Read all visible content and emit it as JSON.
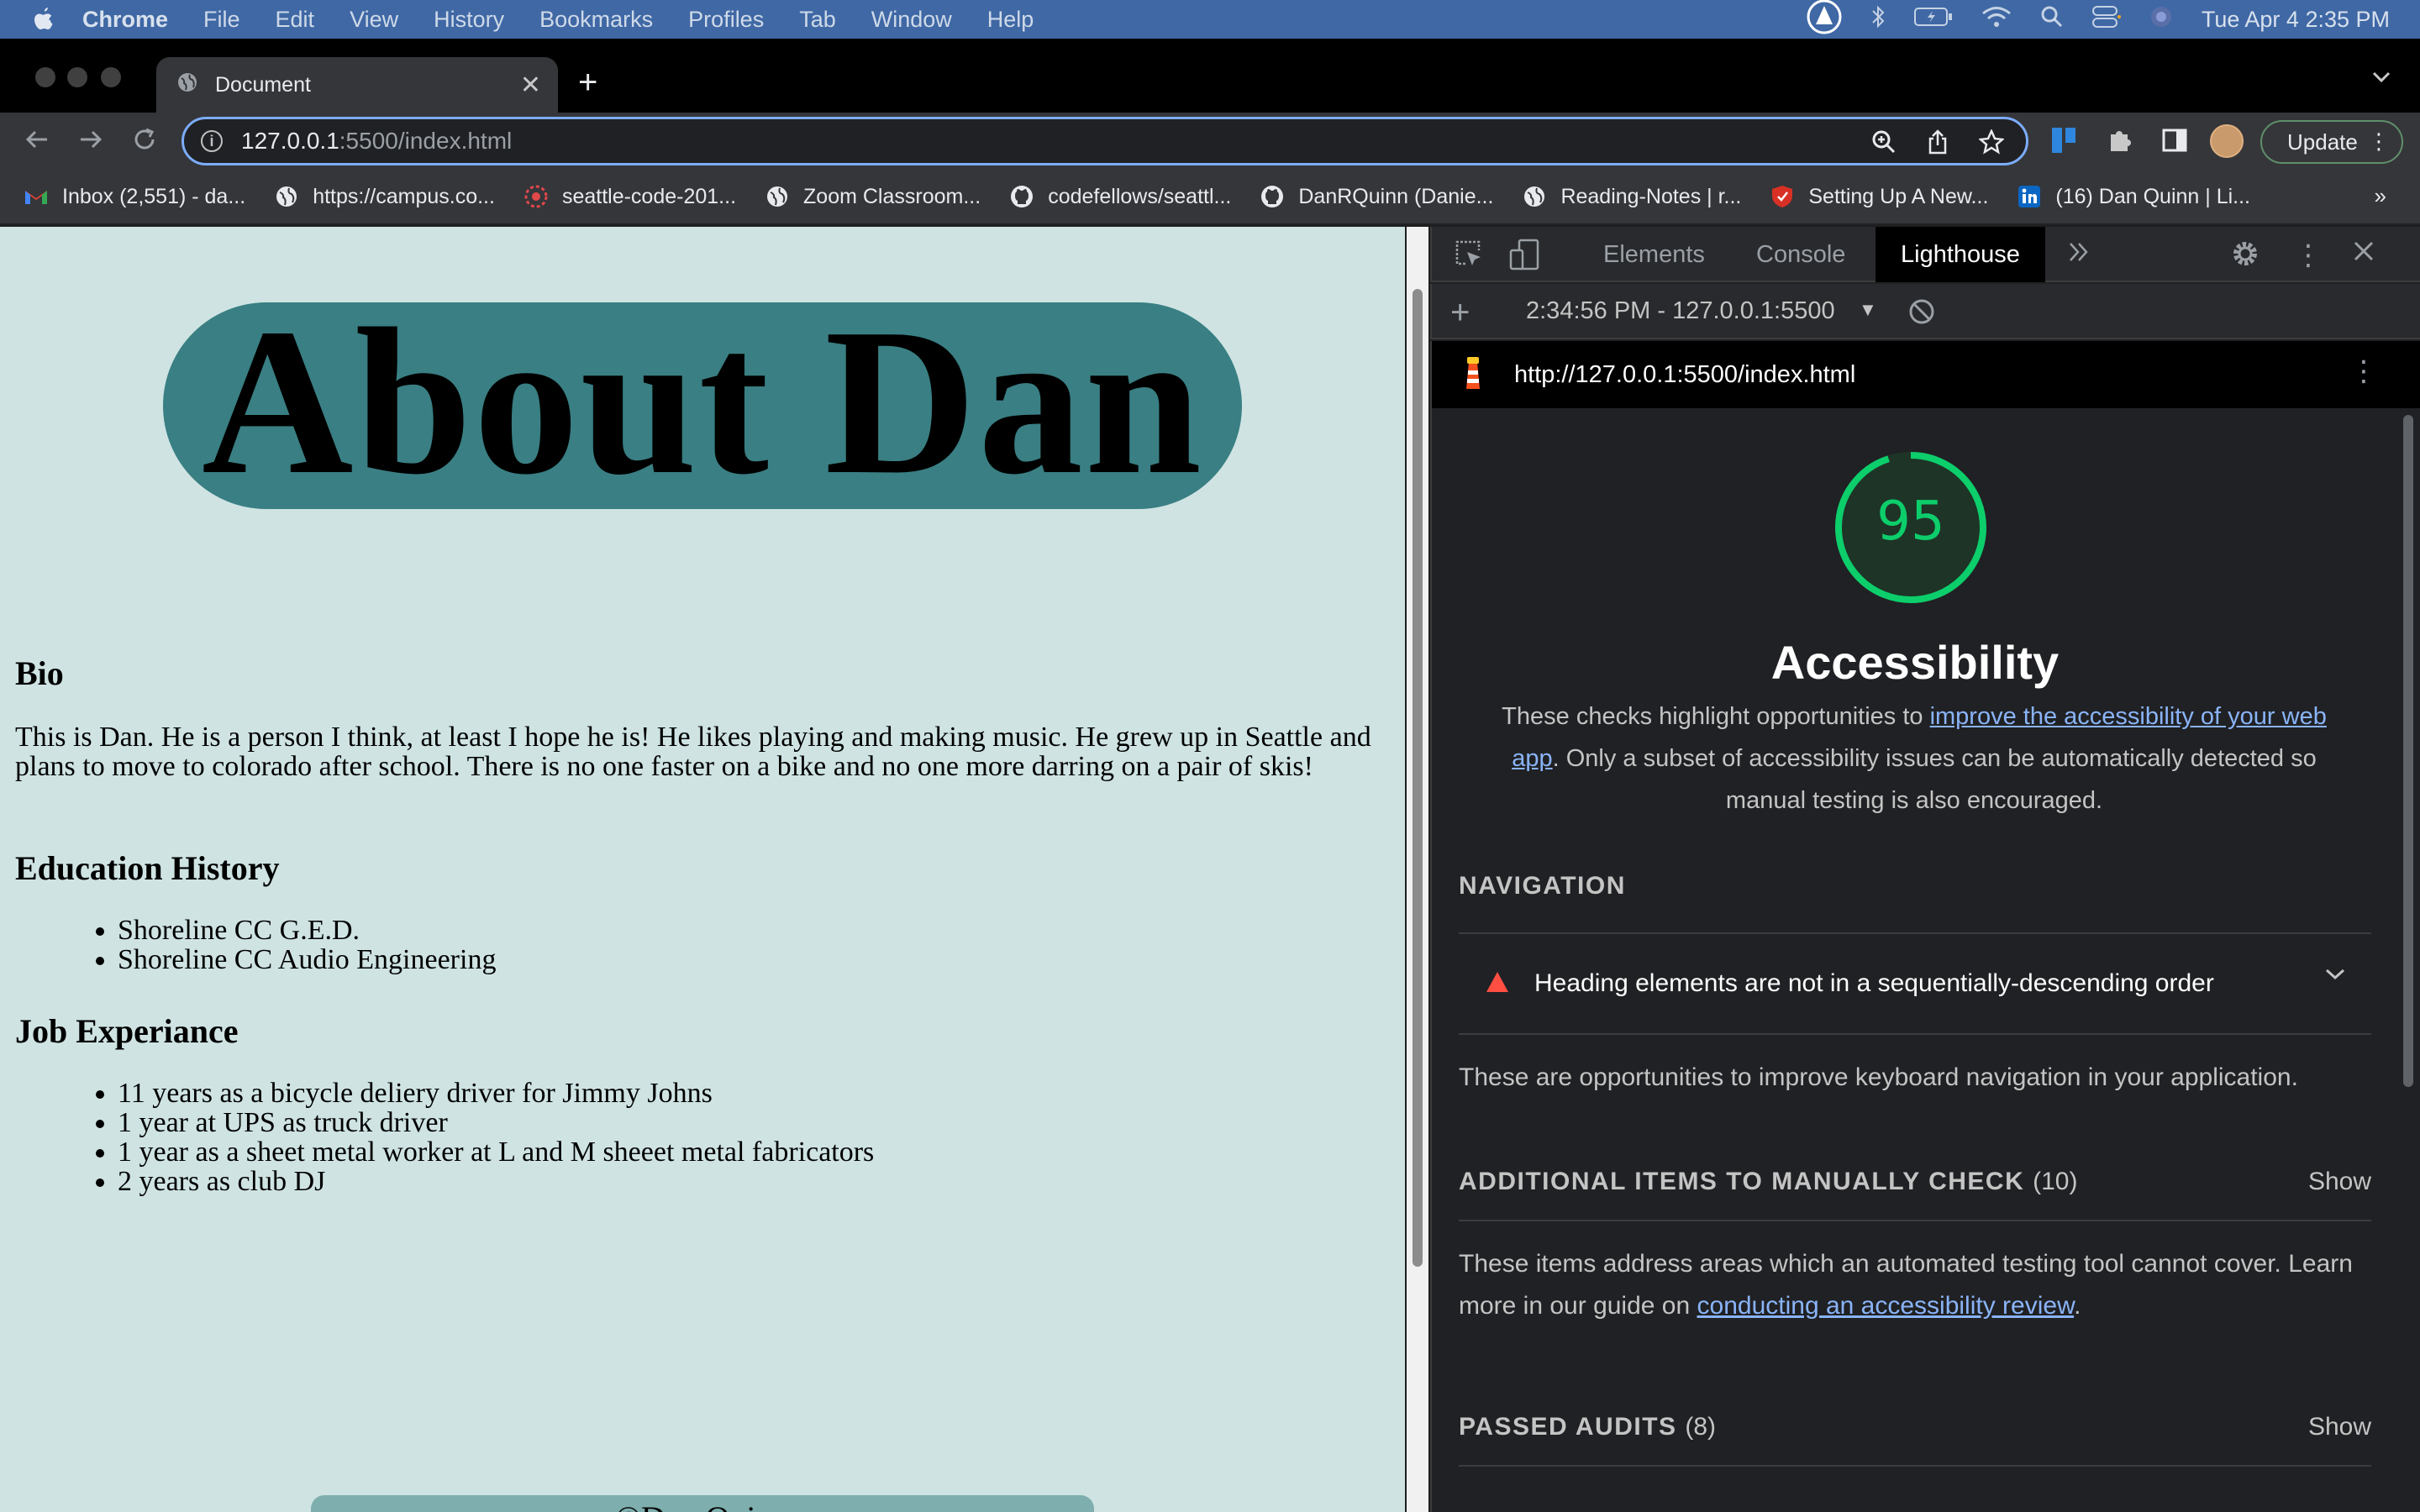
{
  "menubar": {
    "app_name": "Chrome",
    "items": [
      "File",
      "Edit",
      "View",
      "History",
      "Bookmarks",
      "Profiles",
      "Tab",
      "Window",
      "Help"
    ],
    "clock": "Tue Apr 4  2:35 PM"
  },
  "browser": {
    "tab_title": "Document",
    "url_host": "127.0.0.1",
    "url_rest": ":5500/index.html",
    "update_label": "Update",
    "bookmarks": [
      {
        "label": "Inbox (2,551) - da...",
        "icon": "gmail-icon"
      },
      {
        "label": "https://campus.co...",
        "icon": "globe-icon"
      },
      {
        "label": "seattle-code-201...",
        "icon": "codefellows-icon"
      },
      {
        "label": "Zoom Classroom...",
        "icon": "globe-icon"
      },
      {
        "label": "codefellows/seattl...",
        "icon": "github-icon"
      },
      {
        "label": "DanRQuinn (Danie...",
        "icon": "github-icon"
      },
      {
        "label": "Reading-Notes | r...",
        "icon": "globe-icon"
      },
      {
        "label": "Setting Up A New...",
        "icon": "shield-icon"
      },
      {
        "label": "(16) Dan Quinn | Li...",
        "icon": "linkedin-icon"
      }
    ],
    "bookmarks_more": "»"
  },
  "page": {
    "banner_title": "About Dan",
    "bio_heading": "Bio",
    "bio_text": "This is Dan. He is a person I think, at least I hope he is! He likes playing and making music. He grew up in Seattle and plans to move to colorado after school. There is no one faster on a bike and no one more darring on a pair of skis!",
    "education_heading": "Education History",
    "education": [
      "Shoreline CC G.E.D.",
      "Shoreline CC Audio Engineering"
    ],
    "job_heading": "Job Experiance",
    "jobs": [
      "11 years as a bicycle deliery driver for Jimmy Johns",
      "1 year at UPS as truck driver",
      "1 year as a sheet metal worker at L and M sheeet metal fabricators",
      "2 years as club DJ"
    ],
    "footer": "©Dan Quinn"
  },
  "devtools": {
    "tabs": [
      "Elements",
      "Console",
      "Lighthouse"
    ],
    "active_tab": "Lighthouse",
    "report_selector": "2:34:56 PM - 127.0.0.1:5500",
    "report_url": "http://127.0.0.1:5500/index.html",
    "score": "95",
    "score_fraction": 0.95,
    "score_color": "#0cce6b",
    "category_title": "Accessibility",
    "desc_pre": "These checks highlight opportunities to ",
    "desc_link": "improve the accessibility of your web app",
    "desc_post": ". Only a subset of accessibility issues can be automatically detected so manual testing is also encouraged.",
    "nav_heading": "NAVIGATION",
    "audit_title": "Heading elements are not in a sequentially-descending order",
    "nav_note": "These are opportunities to improve keyboard navigation in your application.",
    "manual_heading": "ADDITIONAL ITEMS TO MANUALLY CHECK",
    "manual_count": "(10)",
    "manual_show": "Show",
    "manual_note_pre": "These items address areas which an automated testing tool cannot cover. Learn more in our guide on ",
    "manual_note_link": "conducting an accessibility review",
    "manual_note_post": ".",
    "passed_heading": "PASSED AUDITS",
    "passed_count": "(8)",
    "passed_show": "Show",
    "fail_color": "#ff4e42"
  }
}
